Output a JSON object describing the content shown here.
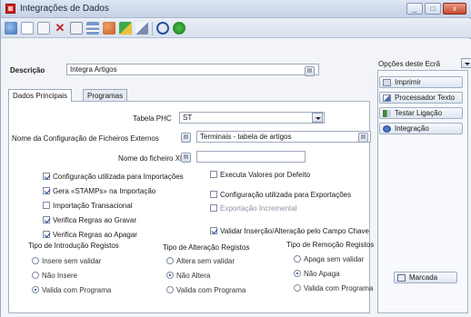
{
  "window": {
    "title": "Integrações de Dados",
    "controls": [
      "_",
      "□",
      "x"
    ]
  },
  "toolbar": {
    "icons": [
      "back-icon",
      "new-icon",
      "open-icon",
      "delete-icon",
      "copy-icon",
      "list-icon",
      "people-icon",
      "shapes-icon",
      "edit-icon",
      "stop-icon",
      "refresh-icon"
    ]
  },
  "form": {
    "descricao_label": "Descrição",
    "descricao_value": "Integra Artigos",
    "tabs": [
      "Dados Principais",
      "Programas"
    ],
    "tabela_phc_label": "Tabela PHC",
    "tabela_phc_value": "ST",
    "config_label": "Nome da Configuração de Ficheiros Externos",
    "config_value": "Terminais - tabela de artigos",
    "xml_label": "Nome do ficheiro XML",
    "xml_value": ""
  },
  "checks": {
    "import_config": "Configuração utilizada para Importações",
    "gera_stamps": "Gera «STAMPs» na Importação",
    "import_transacional": "Importação Transacional",
    "verifica_gravar": "Verifica Regras ao Gravar",
    "verifica_apagar": "Verifica Regras ao Apagar",
    "executa_valores": "Executa Valores por Defeito",
    "export_config": "Configuração utilizada para Exportações",
    "export_incremental": "Exportação Incremental",
    "validar_insercao": "Validar Inserção/Alteração pelo Campo Chave"
  },
  "groups": {
    "introducao": {
      "title": "Tipo de Introdução Registos",
      "options": [
        "Insere sem validar",
        "Não Insere",
        "Valida com Programa"
      ],
      "selected": "Valida com Programa"
    },
    "alteracao": {
      "title": "Tipo de Alteração Registos",
      "options": [
        "Altera sem validar",
        "Não Altera",
        "Valida com Programa"
      ],
      "selected": "Não Altera"
    },
    "remocao": {
      "title": "Tipo de Remoção Registos",
      "options": [
        "Apaga sem validar",
        "Não Apaga",
        "Valida com Programa"
      ],
      "selected": "Não Apaga"
    }
  },
  "sidebar": {
    "options_label": "Opções deste Ecrã",
    "buttons": [
      "Imprimir",
      "Processador Texto",
      "Testar Ligação",
      "Integração"
    ],
    "marcada_label": "Marcada"
  },
  "colors": {
    "accent": "#1d3f8a",
    "app_icon": "#d42020",
    "close_button": "#c84a2f"
  }
}
